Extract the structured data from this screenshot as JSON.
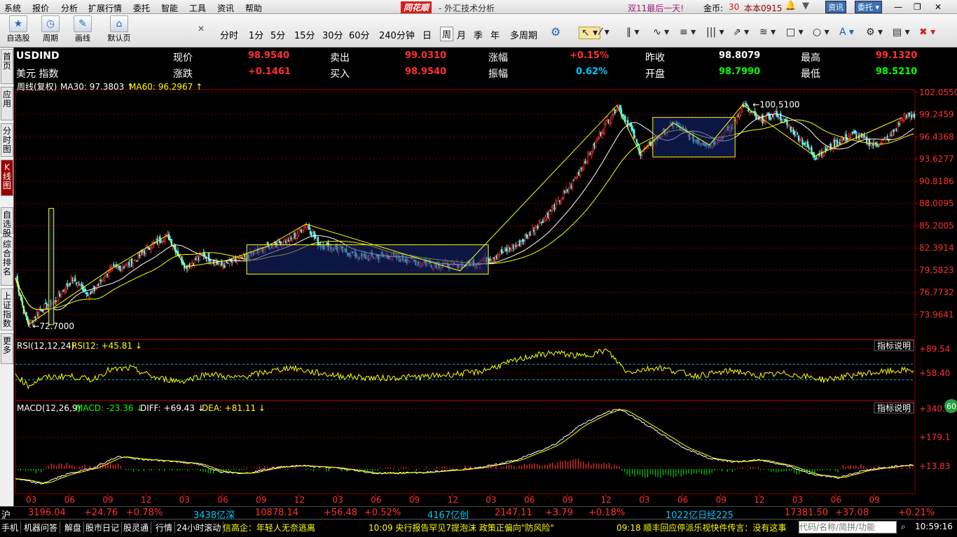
{
  "menubar": {
    "items": [
      "系统",
      "报价",
      "分析",
      "扩展行情",
      "委托",
      "智能",
      "工具",
      "资讯",
      "帮助"
    ],
    "brand": "同花顺",
    "app_title": "外汇技术分析",
    "promo": "双11最后一天!",
    "gold_label": "金币:",
    "gold_value": "30",
    "user": "本本0915",
    "news_btn": "资讯",
    "trade_btn": "委托"
  },
  "toolbar": {
    "buttons": [
      {
        "label": "自选股",
        "icon": "star-icon"
      },
      {
        "label": "周期",
        "icon": "clock-icon"
      },
      {
        "label": "画线",
        "icon": "pencil-icon"
      },
      {
        "label": "默认页",
        "icon": "home-icon"
      }
    ],
    "periods": [
      "分时",
      "1分",
      "5分",
      "15分",
      "30分",
      "60分",
      "240分钟",
      "日",
      "周",
      "月",
      "季",
      "年",
      "多周期"
    ],
    "selected_period": "周",
    "draw_tools": [
      "cursor-icon",
      "line-icon",
      "parallel-icon",
      "wave-icon",
      "fib-icon",
      "bars-icon",
      "channel-icon",
      "gann-icon",
      "rect-icon",
      "ellipse-icon",
      "text-icon",
      "settings-icon",
      "flag-icon",
      "delete-icon"
    ]
  },
  "sidebar": [
    "首页",
    "应用",
    "分时图",
    "K线图",
    "自选股",
    "综合排名",
    "上证指数",
    "更多"
  ],
  "sidebar_active": "K线图",
  "quote": {
    "symbol": "USDIND",
    "name": "美元 指数",
    "rows": [
      [
        {
          "k": "现价",
          "v": "98.9540",
          "c": "#ff3030"
        },
        {
          "k": "卖出",
          "v": "99.0310",
          "c": "#ff3030"
        },
        {
          "k": "涨幅",
          "v": "+0.15%",
          "c": "#ff3030"
        },
        {
          "k": "昨收",
          "v": "98.8079",
          "c": "#ffffff"
        },
        {
          "k": "最高",
          "v": "99.1320",
          "c": "#ff3030"
        }
      ],
      [
        {
          "k": "涨跌",
          "v": "+0.1461",
          "c": "#ff3030"
        },
        {
          "k": "买入",
          "v": "98.9540",
          "c": "#ff3030"
        },
        {
          "k": "振幅",
          "v": "0.62%",
          "c": "#00c8ff"
        },
        {
          "k": "开盘",
          "v": "98.7990",
          "c": "#00ff00"
        },
        {
          "k": "最低",
          "v": "98.5210",
          "c": "#00ff00"
        }
      ]
    ]
  },
  "main_panel": {
    "title": "周线(复权)",
    "ma30_label": "MA30: 97.3803",
    "ma60_label": "MA60: 96.2967",
    "annot_high": "100.5100",
    "annot_low": "72.7000"
  },
  "rsi_panel": {
    "title": "RSI(12,12,24)",
    "value": "RSI12: +45.81",
    "help": "指标说明"
  },
  "macd_panel": {
    "title": "MACD(12,26,9)",
    "macd": "MACD: -23.36",
    "diff": "DIFF: +69.43",
    "dea": "DEA: +81.11",
    "help": "指标说明"
  },
  "chart_data": {
    "type": "candlestick",
    "y_ticks": [
      "102.0550",
      "99.2459",
      "96.4368",
      "93.6277",
      "90.8186",
      "88.0095",
      "85.2005",
      "82.3914",
      "79.5823",
      "76.7732",
      "73.9641"
    ],
    "ylim": [
      71.0,
      102.055
    ],
    "x_ticks": [
      "03",
      "06",
      "09",
      "12",
      "03",
      "06",
      "09",
      "12",
      "03",
      "06",
      "09",
      "12",
      "03",
      "06",
      "09",
      "12",
      "03",
      "06",
      "09",
      "12",
      "03",
      "06",
      "09"
    ],
    "rsi_ticks": [
      "+89.54",
      "+58.40"
    ],
    "macd_ticks": [
      "+340.1",
      "+179.1",
      "+13.83"
    ],
    "price_anchors": [
      [
        0,
        78.6
      ],
      [
        6,
        74.5
      ],
      [
        10,
        72.7
      ],
      [
        18,
        74.5
      ],
      [
        30,
        75.6
      ],
      [
        44,
        78.5
      ],
      [
        58,
        76.5
      ],
      [
        72,
        79.5
      ],
      [
        90,
        80.5
      ],
      [
        104,
        82.6
      ],
      [
        118,
        84.0
      ],
      [
        132,
        80.0
      ],
      [
        146,
        81.6
      ],
      [
        160,
        80.2
      ],
      [
        176,
        81.0
      ],
      [
        196,
        82.6
      ],
      [
        214,
        83.5
      ],
      [
        226,
        85.4
      ],
      [
        236,
        82.8
      ],
      [
        252,
        82.2
      ],
      [
        270,
        81.2
      ],
      [
        292,
        81.4
      ],
      [
        312,
        80.6
      ],
      [
        330,
        80.3
      ],
      [
        348,
        80.2
      ],
      [
        360,
        80.7
      ],
      [
        376,
        81.6
      ],
      [
        392,
        83.0
      ],
      [
        410,
        86.0
      ],
      [
        430,
        89.8
      ],
      [
        446,
        94.2
      ],
      [
        460,
        98.4
      ],
      [
        468,
        100.4
      ],
      [
        478,
        97.6
      ],
      [
        486,
        94.4
      ],
      [
        500,
        96.4
      ],
      [
        512,
        98.2
      ],
      [
        526,
        96.2
      ],
      [
        540,
        95.4
      ],
      [
        556,
        97.6
      ],
      [
        566,
        100.51
      ],
      [
        578,
        98.4
      ],
      [
        592,
        99.4
      ],
      [
        608,
        96.6
      ],
      [
        622,
        94.0
      ],
      [
        636,
        95.4
      ],
      [
        652,
        96.8
      ],
      [
        668,
        95.4
      ],
      [
        680,
        96.4
      ],
      [
        690,
        98.9
      ]
    ],
    "rsi_anchors": [
      [
        0,
        57
      ],
      [
        10,
        42
      ],
      [
        20,
        52
      ],
      [
        40,
        55
      ],
      [
        60,
        50
      ],
      [
        72,
        62
      ],
      [
        90,
        65
      ],
      [
        110,
        52
      ],
      [
        130,
        48
      ],
      [
        150,
        58
      ],
      [
        170,
        52
      ],
      [
        196,
        60
      ],
      [
        214,
        66
      ],
      [
        230,
        60
      ],
      [
        252,
        55
      ],
      [
        280,
        52
      ],
      [
        320,
        54
      ],
      [
        360,
        60
      ],
      [
        380,
        70
      ],
      [
        400,
        80
      ],
      [
        420,
        85
      ],
      [
        440,
        80
      ],
      [
        460,
        88
      ],
      [
        476,
        60
      ],
      [
        500,
        66
      ],
      [
        530,
        55
      ],
      [
        560,
        62
      ],
      [
        575,
        55
      ],
      [
        600,
        58
      ],
      [
        630,
        50
      ],
      [
        660,
        58
      ],
      [
        690,
        62
      ]
    ],
    "macd_anchors": [
      [
        0,
        -55
      ],
      [
        10,
        -70
      ],
      [
        20,
        -85
      ],
      [
        40,
        -30
      ],
      [
        60,
        5
      ],
      [
        80,
        70
      ],
      [
        96,
        55
      ],
      [
        120,
        45
      ],
      [
        140,
        30
      ],
      [
        160,
        -15
      ],
      [
        180,
        -25
      ],
      [
        200,
        5
      ],
      [
        220,
        20
      ],
      [
        250,
        5
      ],
      [
        280,
        -25
      ],
      [
        320,
        -20
      ],
      [
        360,
        5
      ],
      [
        390,
        50
      ],
      [
        420,
        140
      ],
      [
        440,
        250
      ],
      [
        460,
        320
      ],
      [
        470,
        340
      ],
      [
        480,
        300
      ],
      [
        500,
        210
      ],
      [
        520,
        120
      ],
      [
        540,
        60
      ],
      [
        560,
        40
      ],
      [
        580,
        50
      ],
      [
        600,
        20
      ],
      [
        620,
        -30
      ],
      [
        640,
        -50
      ],
      [
        660,
        -10
      ],
      [
        690,
        20
      ]
    ],
    "boxes": [
      [
        180,
        368,
        79.1,
        82.8
      ],
      [
        496,
        560,
        93.9,
        98.9
      ]
    ]
  },
  "ticker": {
    "items": [
      {
        "t": "沪",
        "c": "#ffffff"
      },
      {
        "t": "3196.04",
        "c": "#ff3030"
      },
      {
        "t": "+24.76",
        "c": "#ff3030"
      },
      {
        "t": "+0.78%",
        "c": "#ff3030"
      },
      {
        "t": "3438亿深",
        "c": "#00c8ff"
      },
      {
        "t": "10878.14",
        "c": "#ff3030"
      },
      {
        "t": "+56.48",
        "c": "#ff3030"
      },
      {
        "t": "+0.52%",
        "c": "#ff3030"
      },
      {
        "t": "4167亿创",
        "c": "#00c8ff"
      },
      {
        "t": "2147.11",
        "c": "#ff3030"
      },
      {
        "t": "+3.79",
        "c": "#ff3030"
      },
      {
        "t": "+0.18%",
        "c": "#ff3030"
      },
      {
        "t": "1022亿日经225",
        "c": "#00c8ff"
      },
      {
        "t": "17381.50",
        "c": "#ff3030"
      },
      {
        "t": "+37.08",
        "c": "#ff3030"
      },
      {
        "t": "+0.21%",
        "c": "#ff3030"
      }
    ]
  },
  "status": {
    "tabs": [
      "手机",
      "机器问答",
      "解盘",
      "股市日记",
      "股灵通",
      "行情",
      "24小时滚动"
    ],
    "news1": "信高企：年轻人无奈逃离",
    "news2": "10:09 央行报告罕见7提泡沫 政策正偏向\"防风险\"",
    "news3": "09:18 顺丰回应停派乐视快件传言：没有这事",
    "search_placeholder": "代码/名称/简拼/功能",
    "clock": "10:59:16",
    "badge": "60"
  }
}
